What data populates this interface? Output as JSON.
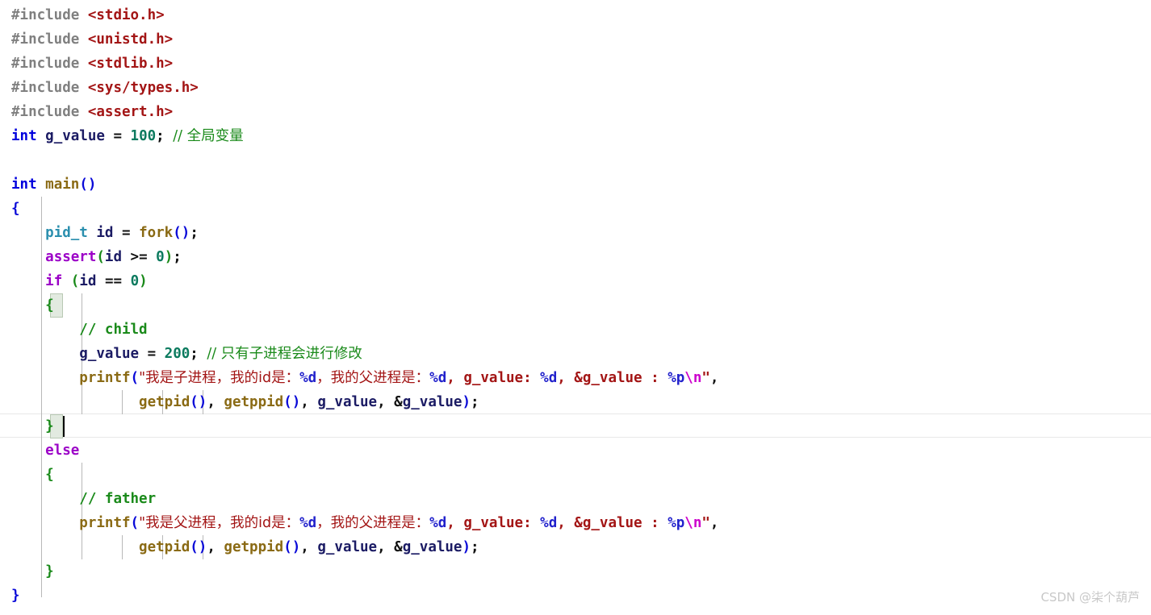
{
  "editor": {
    "background": "#ffffff",
    "font_size_px": 17.5,
    "line_height_px": 30,
    "language": "c",
    "cursor": {
      "line": 17,
      "column": 6
    }
  },
  "palette": {
    "preprocessor": "#808080",
    "header": "#a31515",
    "keyword": "#0000dd",
    "control": "#9b00c7",
    "type": "#2b8fae",
    "identifier": "#1b1b64",
    "function": "#8a6a14",
    "number": "#0b7a5e",
    "comment": "#1a8a1a",
    "string": "#a31515",
    "format_spec": "#2222cc",
    "escape": "#cc00cc",
    "brace_green": "#1a8a1a",
    "brace_blue": "#0a0ad8",
    "bracket_match_bg": "#e2eae0",
    "indent_guide": "#b8b8b8",
    "current_line_border": "#e8e8e8",
    "watermark": "#c8c8c8"
  },
  "code": {
    "lines": [
      {
        "n": 1,
        "text": "#include <stdio.h>"
      },
      {
        "n": 2,
        "text": "#include <unistd.h>"
      },
      {
        "n": 3,
        "text": "#include <stdlib.h>"
      },
      {
        "n": 4,
        "text": "#include <sys/types.h>"
      },
      {
        "n": 5,
        "text": "#include <assert.h>"
      },
      {
        "n": 6,
        "text": "int g_value = 100; // 全局变量"
      },
      {
        "n": 7,
        "text": ""
      },
      {
        "n": 8,
        "text": "int main()"
      },
      {
        "n": 9,
        "text": "{"
      },
      {
        "n": 10,
        "text": "    pid_t id = fork();"
      },
      {
        "n": 11,
        "text": "    assert(id >= 0);"
      },
      {
        "n": 12,
        "text": "    if (id == 0)"
      },
      {
        "n": 13,
        "text": "    {"
      },
      {
        "n": 14,
        "text": "        // child"
      },
      {
        "n": 15,
        "text": "        g_value = 200; // 只有子进程会进行修改"
      },
      {
        "n": 16,
        "text": "        printf(\"我是子进程，我的id是：%d，我的父进程是：%d, g_value: %d, &g_value : %p\\n\","
      },
      {
        "n": 17,
        "text": "               getpid(), getppid(), g_value, &g_value);"
      },
      {
        "n": 18,
        "text": "    }"
      },
      {
        "n": 19,
        "text": "    else"
      },
      {
        "n": 20,
        "text": "    {"
      },
      {
        "n": 21,
        "text": "        // father"
      },
      {
        "n": 22,
        "text": "        printf(\"我是父进程，我的id是：%d，我的父进程是：%d, g_value: %d, &g_value : %p\\n\","
      },
      {
        "n": 23,
        "text": "               getpid(), getppid(), g_value, &g_value);"
      },
      {
        "n": 24,
        "text": "    }"
      },
      {
        "n": 25,
        "text": "}"
      }
    ],
    "tokens": {
      "include_directive": "#include",
      "header_stdio": "<stdio.h>",
      "header_unistd": "<unistd.h>",
      "header_stdlib": "<stdlib.h>",
      "header_systypes": "<sys/types.h>",
      "header_assert": "<assert.h>",
      "kw_int": "int",
      "kw_if": "if",
      "kw_else": "else",
      "id_g_value": "g_value",
      "id_id": "id",
      "type_pid_t": "pid_t",
      "fn_main": "main",
      "fn_fork": "fork",
      "fn_printf": "printf",
      "fn_getpid": "getpid",
      "fn_getppid": "getppid",
      "macro_assert": "assert",
      "num_100": "100",
      "num_200": "200",
      "num_0": "0",
      "cmt_global": "// 全局变量",
      "cmt_child": "// child",
      "cmt_father": "// father",
      "cmt_only_child_modifies": "// 只有子进程会进行修改",
      "str_child_prefix": "\"我是子进程，我的id是：",
      "str_father_prefix": "\"我是父进程，我的id是：",
      "str_my_parent_is": "，我的父进程是：",
      "str_gvalue_label": ", g_value: ",
      "str_amp_gvalue_label": ", &g_value : ",
      "fmt_d": "%d",
      "fmt_p": "%p",
      "esc_newline": "\\n",
      "arg_list": "getpid(), getppid(), g_value, &g_value);"
    }
  },
  "watermark": {
    "text": "CSDN @柒个葫芦"
  }
}
